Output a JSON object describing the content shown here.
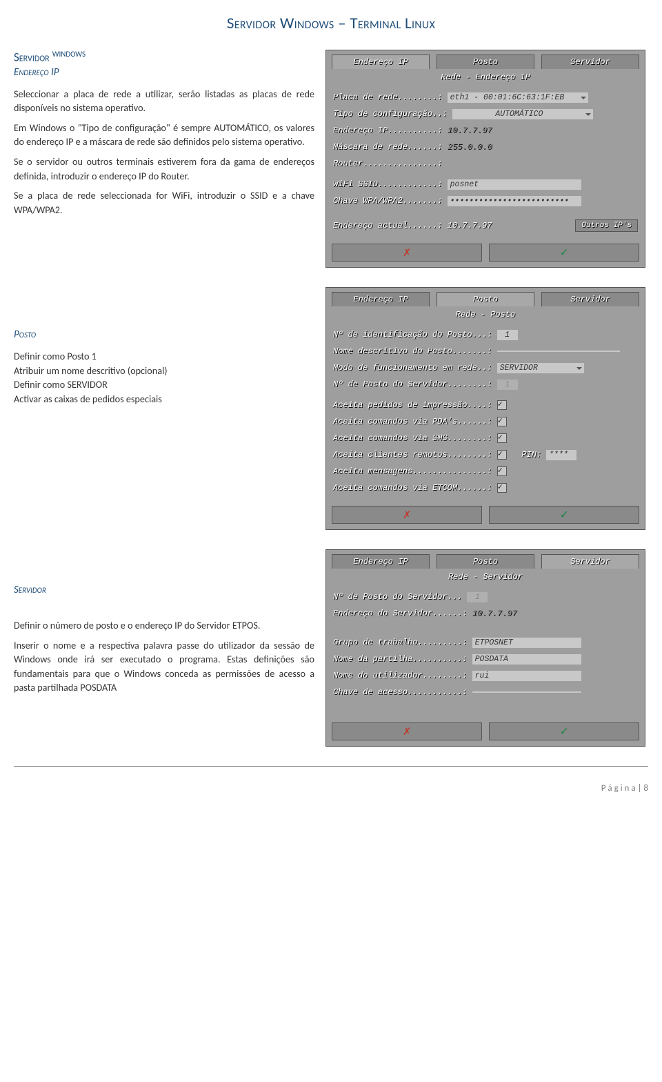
{
  "title": "Servidor Windows – Terminal Linux",
  "section1": {
    "heading": "Servidor",
    "heading_sup": "WINDOWS",
    "sub": "Endereço IP",
    "p1": "Seleccionar a placa de rede a utilizar, serão listadas as placas de rede disponíveis no sistema operativo.",
    "p2": "Em Windows o \"Tipo de configuração\" é sempre AUTOMÁTICO, os valores do endereço IP e a máscara de rede são definidos pelo sistema operativo.",
    "p3": "Se o servidor ou outros terminais estiverem fora da gama de endereços definida, introduzir o endereço IP do Router.",
    "p4": "Se a placa de rede seleccionada for WiFi, introduzir o SSID e a chave WPA/WPA2."
  },
  "section2": {
    "heading": "Posto",
    "lines": [
      "Definir como Posto 1",
      "Atribuir um nome descritivo (opcional)",
      "Definir como SERVIDOR",
      "Activar as caixas de pedidos especiais"
    ]
  },
  "section3": {
    "heading": "Servidor",
    "p1": "Definir o número de posto e o endereço IP do Servidor ETPOS.",
    "p2": "Inserir o nome e a respectiva palavra passe do utilizador da sessão de Windows onde irá ser executado o programa. Estas definições são fundamentais para que o Windows conceda as permissões de acesso a pasta partilhada POSDATA"
  },
  "panelA": {
    "tabs": [
      "Endereço IP",
      "Posto",
      "Servidor"
    ],
    "subtitle": "Rede - Endereço IP",
    "placa_lbl": "Placa de rede........:",
    "placa_val": "eth1 - 00:01:6C:63:1F:EB",
    "tipo_lbl": "Tipo de configuração..:",
    "tipo_val": "AUTOMÁTICO",
    "end_lbl": "Endereço IP..........:",
    "end_val": "10.7.7.97",
    "masc_lbl": "Máscara de rede......:",
    "masc_val": "255.0.0.0",
    "router_lbl": "Router...............:",
    "router_val": "",
    "ssid_lbl": "WiFi SSID............:",
    "ssid_val": "posnet",
    "wpa_lbl": "Chave WPA/WPA2.......:",
    "wpa_val": "•••••••••••••••••••••••••",
    "addr_lbl": "Endereço actual......:",
    "addr_val": "10.7.7.97",
    "outros": "Outros IP's"
  },
  "panelB": {
    "tabs": [
      "Endereço IP",
      "Posto",
      "Servidor"
    ],
    "subtitle": "Rede - Posto",
    "id_lbl": "Nº de identificação do Posto...:",
    "id_val": "1",
    "nome_lbl": "Nome descritivo do Posto.......:",
    "nome_val": "",
    "modo_lbl": "Modo de funcionamento em rede..:",
    "modo_val": "SERVIDOR",
    "nsrv_lbl": "Nº de Posto do Servidor........:",
    "nsrv_val": "1",
    "a1": "Aceita pedidos de impressão....:",
    "a2": "Aceita comandos via PDA's......:",
    "a3": "Aceita comandos via SMS........:",
    "a4": "Aceita clientes remotos........:",
    "a4pin_lbl": "PIN:",
    "a4pin_val": "****",
    "a5": "Aceita mensagens...............:",
    "a6": "Aceita comandos via ETCOM......:"
  },
  "panelC": {
    "tabs": [
      "Endereço IP",
      "Posto",
      "Servidor"
    ],
    "subtitle": "Rede - Servidor",
    "np_lbl": "Nº de Posto do Servidor...",
    "np_val": "1",
    "es_lbl": "Endereço do Servidor......:",
    "es_val": "10.7.7.97",
    "gt_lbl": "Grupo de trabalho.........:",
    "gt_val": "ETPOSNET",
    "pt_lbl": "Nome da partilha..........:",
    "pt_val": "POSDATA",
    "ut_lbl": "Nome do utilizador........:",
    "ut_val": "rui",
    "ch_lbl": "Chave de acesso...........:",
    "ch_val": ""
  },
  "footer": "P á g i n a  | 8"
}
